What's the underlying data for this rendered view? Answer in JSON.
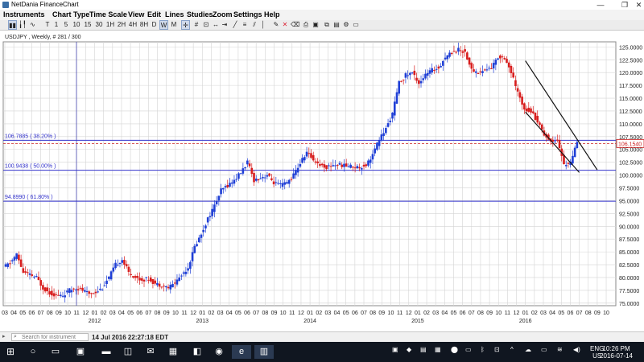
{
  "window": {
    "title": "NetDania FinanceChart",
    "controls": [
      "—",
      "❐",
      "✕"
    ]
  },
  "menu": {
    "items": [
      "Instruments",
      "Chart Type",
      "Time Scale",
      "View",
      "Edit",
      "Lines",
      "Studies",
      "Zoom",
      "Settings",
      "Help"
    ]
  },
  "toolbar": {
    "timeframes": [
      "T",
      "1",
      "5",
      "10",
      "15",
      "30",
      "1H",
      "2H",
      "4H",
      "8H",
      "D",
      "W",
      "M"
    ],
    "active_timeframe": "W"
  },
  "chart": {
    "instrument_label": "USDJPY , Weekly, # 281 / 300",
    "current_price_label": "106.1540",
    "fib_labels": [
      "106.7885 ( 38.20% )",
      "100.9438 ( 50.00% )",
      "94.8990 ( 61.80% )"
    ],
    "year_labels": [
      "2012",
      "2013",
      "2014",
      "2015",
      "2016"
    ],
    "colors": {
      "up": "#1f3fd6",
      "down": "#d81e1e",
      "fib_line": "#3333cc",
      "price_line": "#cc2222",
      "grid": "#d4d4d4"
    }
  },
  "chart_data": {
    "type": "candlestick",
    "title": "USDJPY , Weekly, # 281 / 300",
    "ylim": [
      74.5,
      126
    ],
    "y_ticks": [
      75,
      77.5,
      80,
      82.5,
      85,
      87.5,
      90,
      92.5,
      95,
      97.5,
      100,
      102.5,
      105,
      107.5,
      110,
      112.5,
      115,
      117.5,
      120,
      122.5,
      125
    ],
    "x_tick_labels": [
      "03",
      "04",
      "05",
      "06",
      "07",
      "08",
      "09",
      "10",
      "11",
      "12",
      "01",
      "02",
      "03",
      "04",
      "05",
      "06",
      "07",
      "08",
      "09",
      "10",
      "11",
      "12",
      "01",
      "02",
      "03",
      "04",
      "05",
      "06",
      "07",
      "08",
      "09",
      "10",
      "11",
      "12",
      "01",
      "02",
      "03",
      "04",
      "05",
      "06",
      "07",
      "08",
      "09",
      "10",
      "11",
      "12",
      "01",
      "02",
      "03",
      "04",
      "05",
      "06",
      "07",
      "08",
      "09",
      "10",
      "11",
      "12",
      "01",
      "02",
      "03",
      "04",
      "05",
      "06",
      "07",
      "08",
      "09",
      "10"
    ],
    "x_start": "2011-03",
    "fibonacci": [
      {
        "level": 106.7885,
        "pct": "38.20%"
      },
      {
        "level": 100.9438,
        "pct": "50.00%"
      },
      {
        "level": 94.899,
        "pct": "61.80%"
      }
    ],
    "current_price": 106.154,
    "close_path": [
      82,
      82.8,
      84.5,
      81,
      80.5,
      80,
      78,
      77,
      76.5,
      76.5,
      77.5,
      78,
      77.5,
      76.8,
      77.2,
      78,
      80,
      82.5,
      83.5,
      81,
      80,
      79.5,
      79.8,
      78.8,
      78.5,
      78,
      79,
      80.5,
      82,
      86,
      88.5,
      91.5,
      94,
      97,
      98,
      99,
      100.5,
      102.5,
      99,
      99.5,
      100,
      98.5,
      98,
      98.5,
      100,
      102.3,
      104.5,
      103,
      102,
      101.5,
      102,
      102,
      101.8,
      101.7,
      101.5,
      102,
      104,
      107,
      109,
      112,
      118,
      119.5,
      120,
      118,
      119.5,
      120.5,
      121,
      123,
      124,
      124.5,
      124,
      120.5,
      120,
      120.5,
      121,
      123,
      123,
      120,
      116,
      113,
      112.5,
      110.5,
      108,
      106.5,
      107,
      102,
      102.5,
      106.2
    ],
    "trend_channel": {
      "upper": [
        {
          "x": "2016-01",
          "y": 122.3
        },
        {
          "x": "2016-09",
          "y": 101.0
        }
      ],
      "lower": [
        {
          "x": "2016-01",
          "y": 112.3
        },
        {
          "x": "2016-07",
          "y": 100.5
        }
      ]
    }
  },
  "status": {
    "search_placeholder": "Search for instrument",
    "datetime": "14 Jul 2016 22:27:18 EDT"
  },
  "taskbar": {
    "lang_top": "ENG",
    "lang_bottom": "US",
    "time": "10:26 PM",
    "date": "2016-07-14"
  }
}
